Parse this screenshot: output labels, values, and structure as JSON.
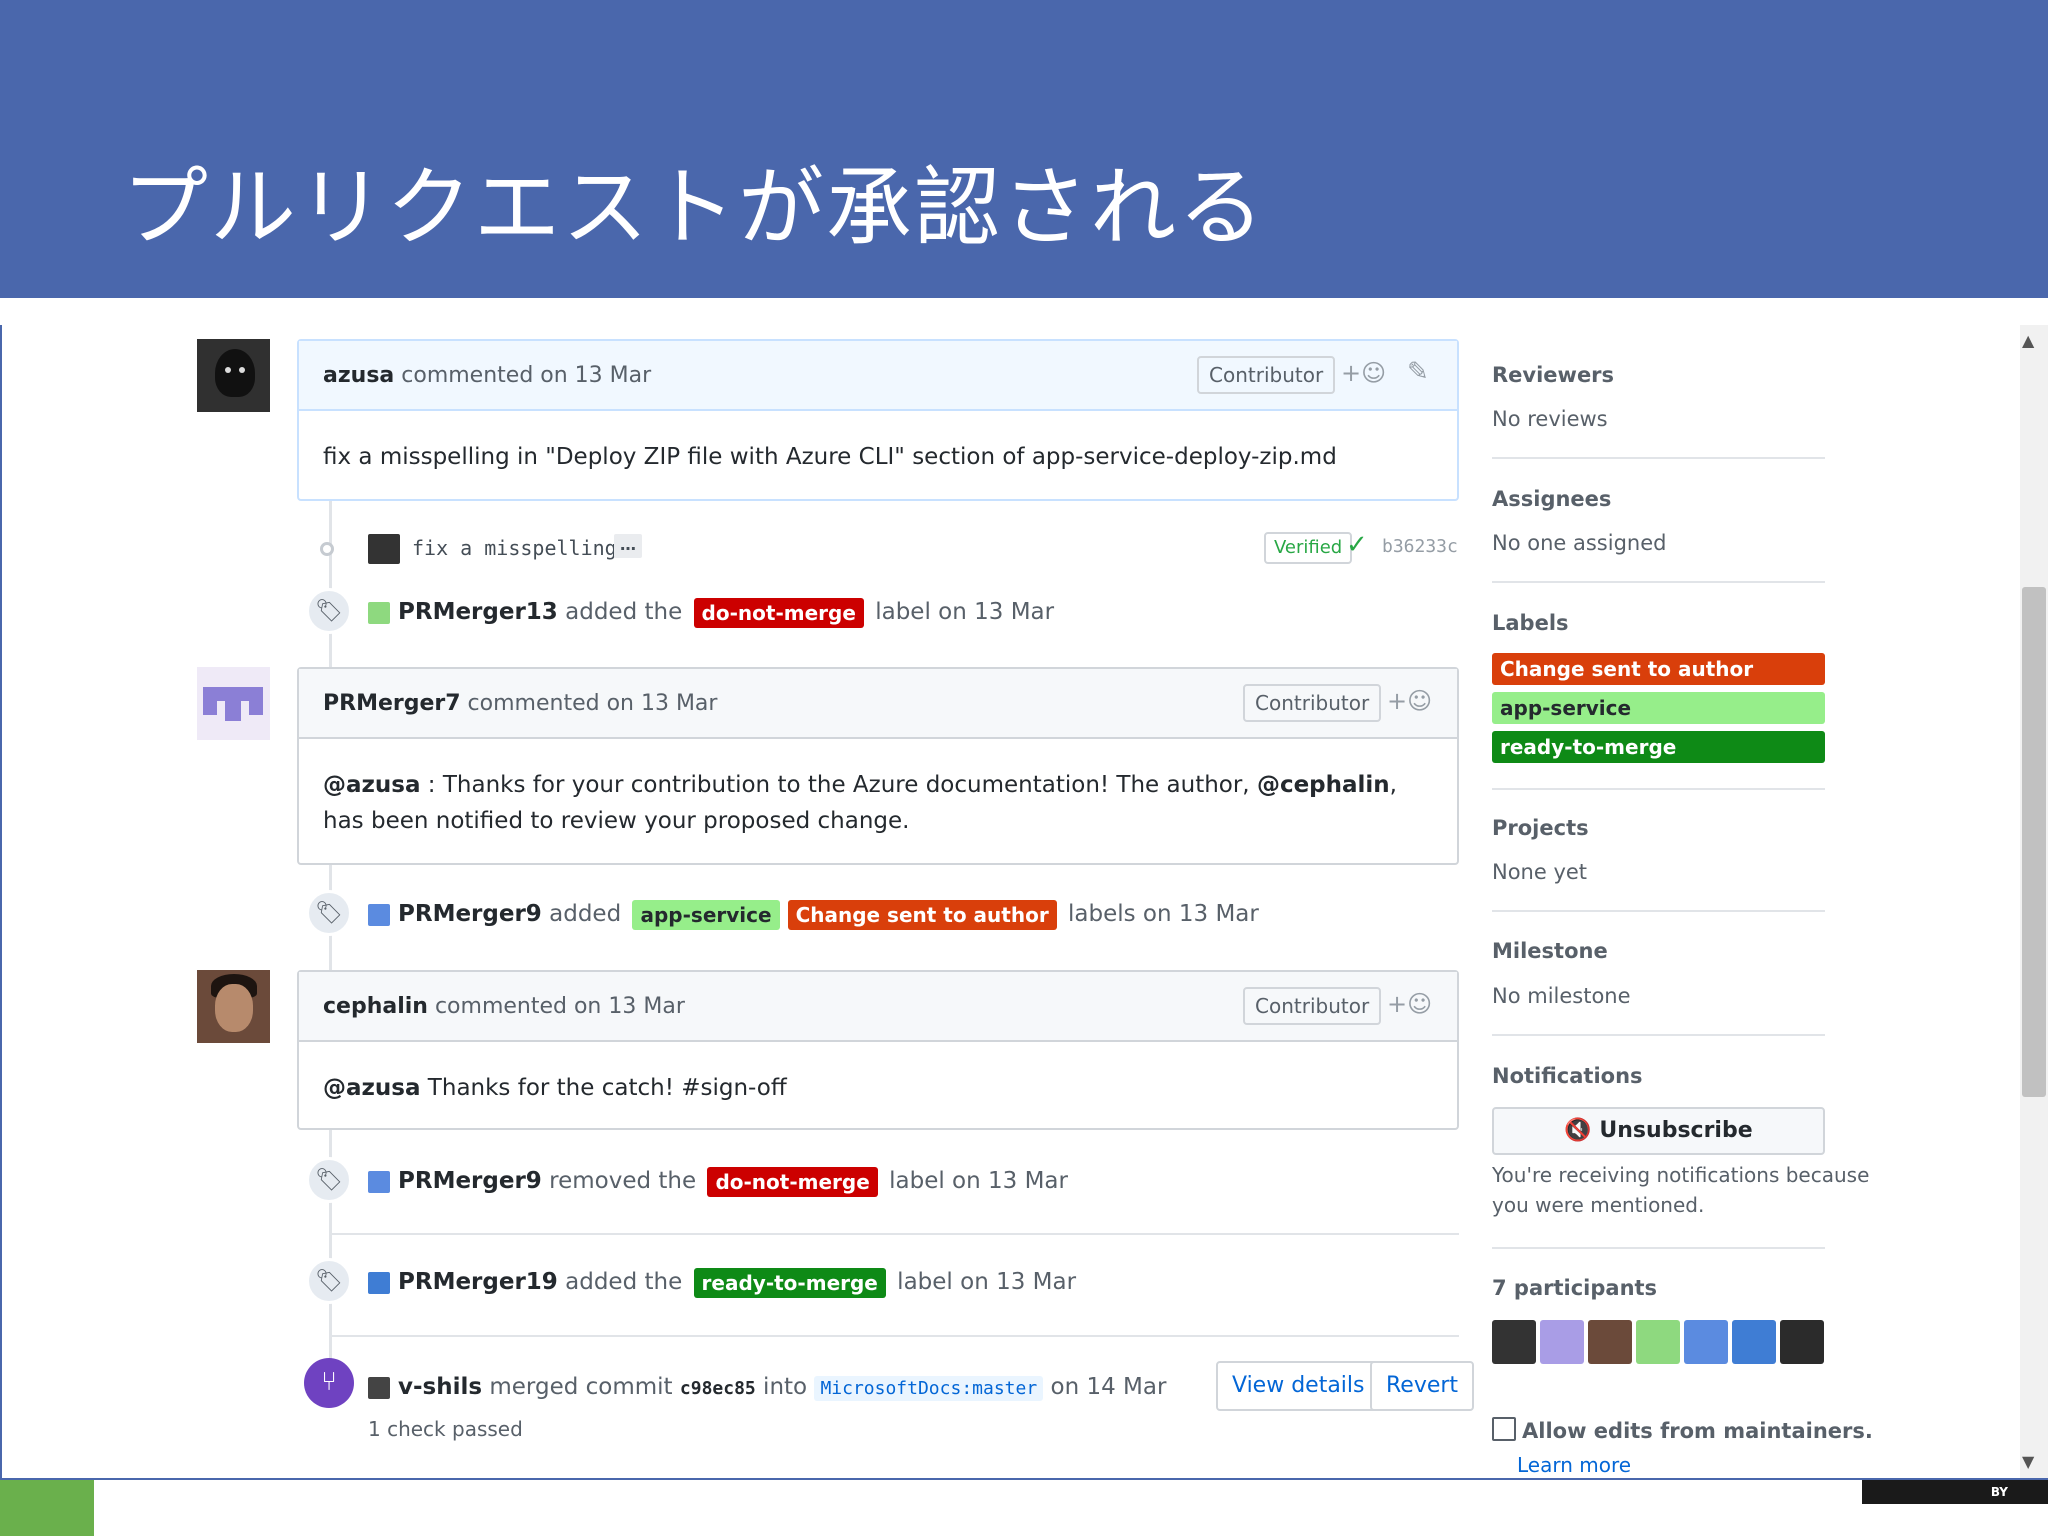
{
  "slide": {
    "title": "プルリクエストが承認される"
  },
  "colors": {
    "header_bg": "#4a67ac",
    "label_do_not_merge": "#cc0000",
    "label_change_sent": "#d93f0b",
    "label_app_service": "#96ee8a",
    "label_ready_to_merge": "#0e8a16",
    "merge_purple": "#6f42c1",
    "link_blue": "#0366d6"
  },
  "comments": [
    {
      "author": "azusa",
      "meta": " commented on 13 Mar",
      "badge": "Contributor",
      "body": "fix a misspelling in \"Deploy ZIP file with Azure CLI\" section of app-service-deploy-zip.md"
    },
    {
      "author": "PRMerger7",
      "meta": " commented on 13 Mar",
      "badge": "Contributor",
      "body_mention1": "@azusa",
      "body_mid": " : Thanks for your contribution to the Azure documentation! The author, ",
      "body_mention2": "@cephalin",
      "body_end": ", has been notified to review your proposed change."
    },
    {
      "author": "cephalin",
      "meta": " commented on 13 Mar",
      "badge": "Contributor",
      "body_mention": "@azusa",
      "body_rest": " Thanks for the catch! #sign-off"
    }
  ],
  "commit": {
    "message": "fix a misspelling",
    "ellipsis": "…",
    "verified": "Verified",
    "sha": "b36233c"
  },
  "events": [
    {
      "actor": "PRMerger13",
      "pre": " added the ",
      "label": "do-not-merge",
      "post": " label on 13 Mar"
    },
    {
      "actor": "PRMerger9",
      "pre": " added ",
      "label1": "app-service",
      "label2": "Change sent to author",
      "post": " labels on 13 Mar"
    },
    {
      "actor": "PRMerger9",
      "pre": " removed the ",
      "label": "do-not-merge",
      "post": " label on 13 Mar"
    },
    {
      "actor": "PRMerger19",
      "pre": " added the ",
      "label": "ready-to-merge",
      "post": " label on 13 Mar"
    }
  ],
  "merge": {
    "actor": "v-shils",
    "pre": " merged commit ",
    "sha": "c98ec85",
    "mid": " into ",
    "branch": "MicrosoftDocs:master",
    "post": " on 14 Mar",
    "checks": "1 check passed",
    "view_details": "View details",
    "revert": "Revert"
  },
  "sidebar": {
    "reviewers": {
      "label": "Reviewers",
      "value": "No reviews"
    },
    "assignees": {
      "label": "Assignees",
      "value": "No one assigned"
    },
    "labels": {
      "label": "Labels",
      "items": [
        "Change sent to author",
        "app-service",
        "ready-to-merge"
      ]
    },
    "projects": {
      "label": "Projects",
      "value": "None yet"
    },
    "milestone": {
      "label": "Milestone",
      "value": "No milestone"
    },
    "notifications": {
      "label": "Notifications",
      "button": "Unsubscribe",
      "note_line1": "You're receiving notifications because",
      "note_line2": "you were mentioned."
    },
    "participants": {
      "label": "7 participants"
    },
    "allow_edits": "Allow edits from maintainers.",
    "learn_more": "Learn more"
  },
  "footer": {
    "license": "BY"
  }
}
